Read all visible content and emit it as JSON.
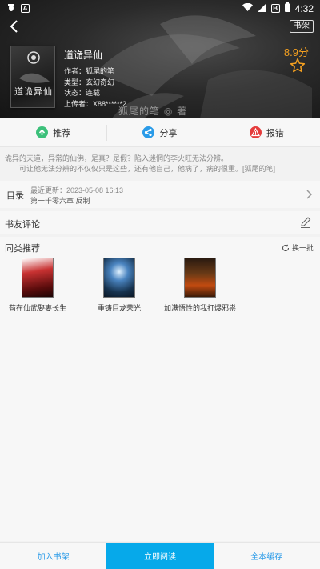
{
  "status_bar": {
    "left_icons": [
      "bug-icon",
      "a-icon"
    ],
    "time": "4:32",
    "b_label": "B"
  },
  "header": {
    "shelf_label": "书架"
  },
  "book": {
    "cover_title": "道诡异仙",
    "title": "道诡异仙",
    "author": "作者：狐尾的笔",
    "genre": "类型：玄幻奇幻",
    "status": "状态：连载",
    "uploader": "上传者：X88******2",
    "score": "8.9分",
    "watermark": "狐尾的笔 ◎ 著"
  },
  "actions": [
    {
      "label": "推荐",
      "icon": "thumb-up-icon"
    },
    {
      "label": "分享",
      "icon": "share-icon"
    },
    {
      "label": "报错",
      "icon": "warning-icon"
    }
  ],
  "description": "诡异的天道，异常的仙佛，是真？是假？陷入迷惘的李火旺无法分辨。\n　　可让他无法分辨的不仅仅只是这些，还有他自己，他病了，病的很重。[狐尾的笔]",
  "toc": {
    "label": "目录",
    "updated": "最近更新：2023-05-08 16:13",
    "latest_chapter": "第一千零六章 反制"
  },
  "reviews": {
    "label": "书友评论"
  },
  "similar": {
    "label": "同类推荐",
    "refresh_label": "换一批",
    "books": [
      {
        "name": "苟在仙武娶妻长生"
      },
      {
        "name": "重铸巨龙荣光"
      },
      {
        "name": "加满悟性的我打爆邪祟"
      }
    ]
  },
  "bottom_bar": {
    "add_shelf": "加入书架",
    "read_now": "立即阅读",
    "cache_all": "全本缓存"
  },
  "colors": {
    "accent": "#06a9ea",
    "score": "#f4a020",
    "recommend": "#3cc07a",
    "share": "#2a9be8",
    "report": "#e53c3c"
  }
}
